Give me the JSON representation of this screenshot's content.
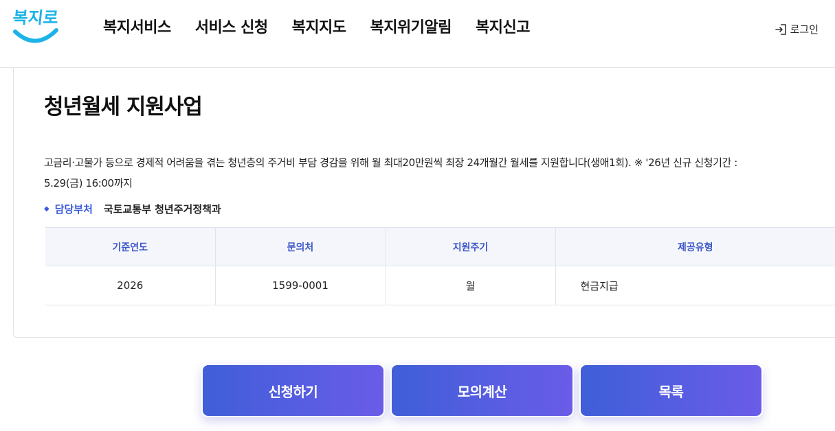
{
  "header": {
    "logo_text": "복지로",
    "nav": [
      "복지서비스",
      "서비스 신청",
      "복지지도",
      "복지위기알림",
      "복지신고"
    ],
    "login_label": "로그인"
  },
  "service": {
    "title": "청년월세 지원사업",
    "description_line1": "고금리·고물가 등으로 경제적 어려움을 겪는 청년층의 주거비 부담 경감을 위해 월 최대20만원씩 최장 24개월간 월세를 지원합니다(생애1회). ※ '26년 신규 신청기간 :",
    "description_line2": "5.29(금) 16:00까지",
    "dept_label": "담당부처",
    "dept_value": "국토교통부 청년주거정책과"
  },
  "table": {
    "headers": [
      "기준연도",
      "문의처",
      "지원주기",
      "제공유형"
    ],
    "row": [
      "2026",
      "1599-0001",
      "월",
      "현금지급"
    ]
  },
  "buttons": {
    "apply": "신청하기",
    "simulate": "모의계산",
    "list": "목록"
  },
  "colors": {
    "accent": "#3d56c9",
    "button_gradient_start": "#3f5fd8",
    "button_gradient_end": "#6a5ce8",
    "logo": "#1bb3e8"
  }
}
